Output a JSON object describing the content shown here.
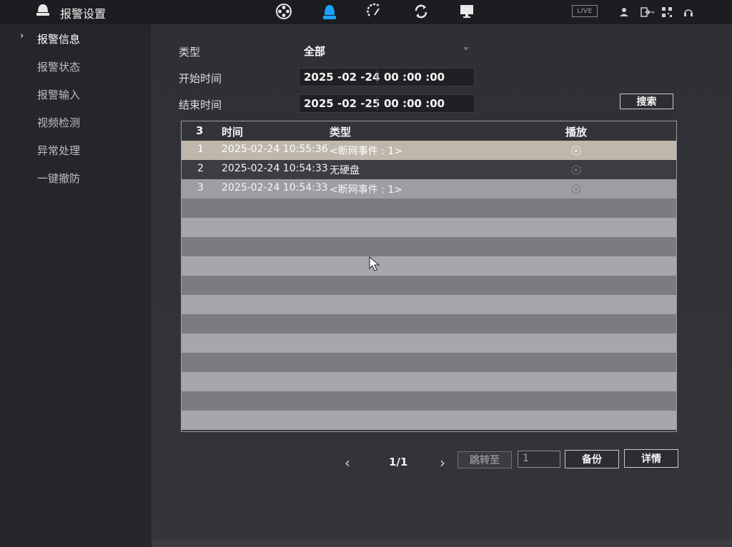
{
  "header": {
    "title": "报警设置",
    "live_label": "LIVE",
    "nav_icons": [
      "film-reel-icon",
      "alarm-bell-icon",
      "gauge-icon",
      "refresh-icon",
      "monitor-icon"
    ],
    "right_icons": [
      "user-icon",
      "logout-icon",
      "qr-icon",
      "headset-icon"
    ]
  },
  "sidebar": {
    "items": [
      {
        "label": "报警信息",
        "active": true
      },
      {
        "label": "报警状态",
        "active": false
      },
      {
        "label": "报警输入",
        "active": false
      },
      {
        "label": "视频检测",
        "active": false
      },
      {
        "label": "异常处理",
        "active": false
      },
      {
        "label": "一键撤防",
        "active": false
      }
    ]
  },
  "filters": {
    "type_label": "类型",
    "type_value": "全部",
    "start_label": "开始时间",
    "start_date": "2025 -02 -24",
    "start_time": "00 :00 :00",
    "end_label": "结束时间",
    "end_date": "2025 -02 -25",
    "end_time": "00 :00 :00",
    "search_button": "搜索"
  },
  "table": {
    "count": "3",
    "columns": [
      "时间",
      "类型",
      "播放"
    ],
    "rows": [
      {
        "index": "1",
        "time": "2025-02-24 10:55:36",
        "type": "<断网事件 : 1>",
        "selected": true
      },
      {
        "index": "2",
        "time": "2025-02-24 10:54:33",
        "type": "无硬盘",
        "selected": false
      },
      {
        "index": "3",
        "time": "2025-02-24 10:54:33",
        "type": "<断网事件 : 1>",
        "selected": false
      }
    ]
  },
  "pager": {
    "prev": "‹",
    "next": "›",
    "page_display": "1/1",
    "jump_button": "跳转至",
    "page_input_value": "1",
    "backup_button": "备份",
    "details_button": "详情"
  },
  "colors": {
    "background": "#2a2c31",
    "selected_row": "#bfb7ac",
    "accent_blue": "#1aa3ff"
  }
}
